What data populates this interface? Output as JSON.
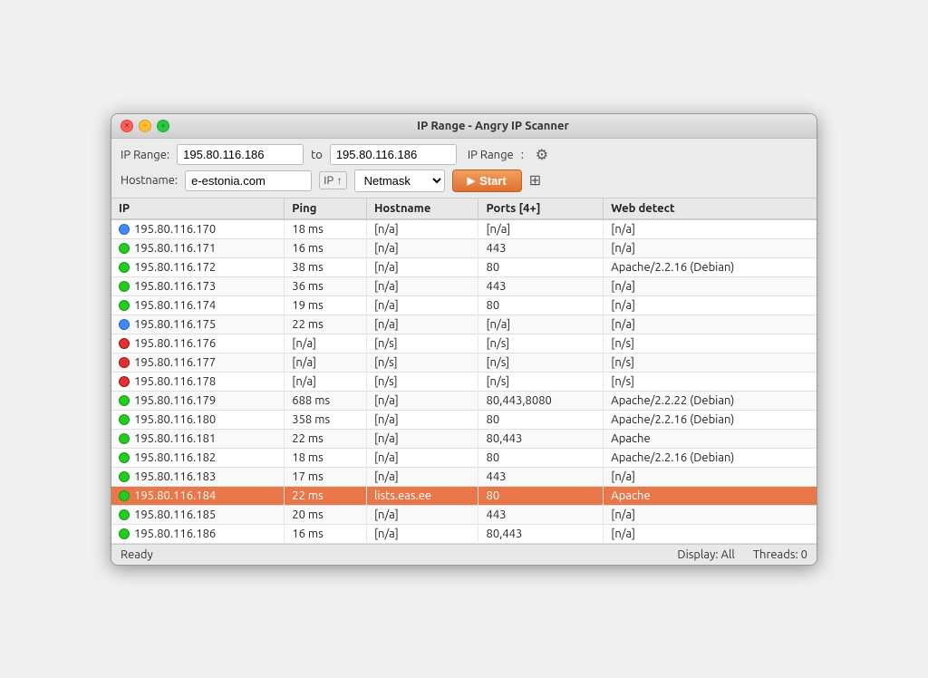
{
  "titlebar": {
    "title": "IP Range - Angry IP Scanner"
  },
  "toolbar": {
    "ip_range_label": "IP Range:",
    "ip_from": "195.80.116.186",
    "to_label": "to",
    "ip_to": "195.80.116.186",
    "range_type_label": "IP Range",
    "hostname_label": "Hostname:",
    "hostname_value": "e-estonia.com",
    "ip_up_label": "IP ↑",
    "netmask_label": "Netmask",
    "start_label": "Start"
  },
  "table": {
    "columns": [
      "IP",
      "Ping",
      "Hostname",
      "Ports [4+]",
      "Web detect"
    ],
    "rows": [
      {
        "ip": "195.80.116.170",
        "status": "blue",
        "ping": "18 ms",
        "hostname": "[n/a]",
        "ports": "[n/a]",
        "webdetect": "[n/a]",
        "selected": false
      },
      {
        "ip": "195.80.116.171",
        "status": "green",
        "ping": "16 ms",
        "hostname": "[n/a]",
        "ports": "443",
        "webdetect": "[n/a]",
        "selected": false
      },
      {
        "ip": "195.80.116.172",
        "status": "green",
        "ping": "38 ms",
        "hostname": "[n/a]",
        "ports": "80",
        "webdetect": "Apache/2.2.16 (Debian)",
        "selected": false
      },
      {
        "ip": "195.80.116.173",
        "status": "green",
        "ping": "36 ms",
        "hostname": "[n/a]",
        "ports": "443",
        "webdetect": "[n/a]",
        "selected": false
      },
      {
        "ip": "195.80.116.174",
        "status": "green",
        "ping": "19 ms",
        "hostname": "[n/a]",
        "ports": "80",
        "webdetect": "[n/a]",
        "selected": false
      },
      {
        "ip": "195.80.116.175",
        "status": "blue",
        "ping": "22 ms",
        "hostname": "[n/a]",
        "ports": "[n/a]",
        "webdetect": "[n/a]",
        "selected": false
      },
      {
        "ip": "195.80.116.176",
        "status": "red",
        "ping": "[n/a]",
        "hostname": "[n/s]",
        "ports": "[n/s]",
        "webdetect": "[n/s]",
        "selected": false
      },
      {
        "ip": "195.80.116.177",
        "status": "red",
        "ping": "[n/a]",
        "hostname": "[n/s]",
        "ports": "[n/s]",
        "webdetect": "[n/s]",
        "selected": false
      },
      {
        "ip": "195.80.116.178",
        "status": "red",
        "ping": "[n/a]",
        "hostname": "[n/s]",
        "ports": "[n/s]",
        "webdetect": "[n/s]",
        "selected": false
      },
      {
        "ip": "195.80.116.179",
        "status": "green",
        "ping": "688 ms",
        "hostname": "[n/a]",
        "ports": "80,443,8080",
        "webdetect": "Apache/2.2.22 (Debian)",
        "selected": false
      },
      {
        "ip": "195.80.116.180",
        "status": "green",
        "ping": "358 ms",
        "hostname": "[n/a]",
        "ports": "80",
        "webdetect": "Apache/2.2.16 (Debian)",
        "selected": false
      },
      {
        "ip": "195.80.116.181",
        "status": "green",
        "ping": "22 ms",
        "hostname": "[n/a]",
        "ports": "80,443",
        "webdetect": "Apache",
        "selected": false
      },
      {
        "ip": "195.80.116.182",
        "status": "green",
        "ping": "18 ms",
        "hostname": "[n/a]",
        "ports": "80",
        "webdetect": "Apache/2.2.16 (Debian)",
        "selected": false
      },
      {
        "ip": "195.80.116.183",
        "status": "green",
        "ping": "17 ms",
        "hostname": "[n/a]",
        "ports": "443",
        "webdetect": "[n/a]",
        "selected": false
      },
      {
        "ip": "195.80.116.184",
        "status": "green",
        "ping": "22 ms",
        "hostname": "lists.eas.ee",
        "ports": "80",
        "webdetect": "Apache",
        "selected": true
      },
      {
        "ip": "195.80.116.185",
        "status": "green",
        "ping": "20 ms",
        "hostname": "[n/a]",
        "ports": "443",
        "webdetect": "[n/a]",
        "selected": false
      },
      {
        "ip": "195.80.116.186",
        "status": "green",
        "ping": "16 ms",
        "hostname": "[n/a]",
        "ports": "80,443",
        "webdetect": "[n/a]",
        "selected": false
      }
    ]
  },
  "statusbar": {
    "status": "Ready",
    "display": "Display: All",
    "threads": "Threads: 0"
  }
}
